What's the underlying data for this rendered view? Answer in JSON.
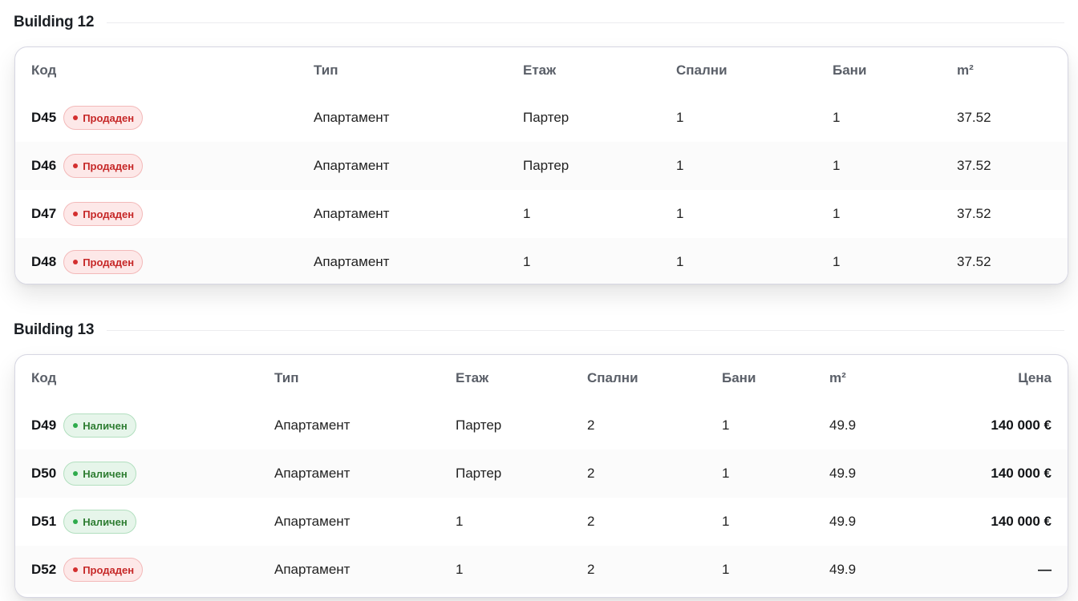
{
  "colors": {
    "sold": "#c62828",
    "available": "#2e7d32",
    "card_border": "#d6d6e2"
  },
  "buildings": [
    {
      "title": "Building 12",
      "headers": {
        "code": "Код",
        "type": "Тип",
        "floor": "Етаж",
        "bedrooms": "Спални",
        "baths": "Бани",
        "area": "m²"
      },
      "rows": [
        {
          "code": "D45",
          "status": "Продаден",
          "status_kind": "sold",
          "type": "Апартамент",
          "floor": "Партер",
          "bedrooms": "1",
          "baths": "1",
          "area": "37.52"
        },
        {
          "code": "D46",
          "status": "Продаден",
          "status_kind": "sold",
          "type": "Апартамент",
          "floor": "Партер",
          "bedrooms": "1",
          "baths": "1",
          "area": "37.52"
        },
        {
          "code": "D47",
          "status": "Продаден",
          "status_kind": "sold",
          "type": "Апартамент",
          "floor": "1",
          "bedrooms": "1",
          "baths": "1",
          "area": "37.52"
        },
        {
          "code": "D48",
          "status": "Продаден",
          "status_kind": "sold",
          "type": "Апартамент",
          "floor": "1",
          "bedrooms": "1",
          "baths": "1",
          "area": "37.52"
        }
      ]
    },
    {
      "title": "Building 13",
      "headers": {
        "code": "Код",
        "type": "Тип",
        "floor": "Етаж",
        "bedrooms": "Спални",
        "baths": "Бани",
        "area": "m²",
        "price": "Цена"
      },
      "rows": [
        {
          "code": "D49",
          "status": "Наличен",
          "status_kind": "avail",
          "type": "Апартамент",
          "floor": "Партер",
          "bedrooms": "2",
          "baths": "1",
          "area": "49.9",
          "price": "140 000 €"
        },
        {
          "code": "D50",
          "status": "Наличен",
          "status_kind": "avail",
          "type": "Апартамент",
          "floor": "Партер",
          "bedrooms": "2",
          "baths": "1",
          "area": "49.9",
          "price": "140 000 €"
        },
        {
          "code": "D51",
          "status": "Наличен",
          "status_kind": "avail",
          "type": "Апартамент",
          "floor": "1",
          "bedrooms": "2",
          "baths": "1",
          "area": "49.9",
          "price": "140 000 €"
        },
        {
          "code": "D52",
          "status": "Продаден",
          "status_kind": "sold",
          "type": "Апартамент",
          "floor": "1",
          "bedrooms": "2",
          "baths": "1",
          "area": "49.9",
          "price": "—"
        }
      ]
    }
  ]
}
